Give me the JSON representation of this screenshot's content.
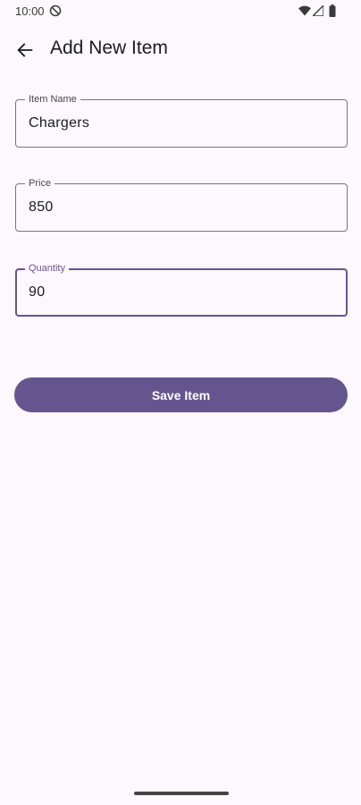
{
  "status_bar": {
    "time": "10:00",
    "icons": [
      "do-not-disturb-icon",
      "wifi-icon",
      "signal-icon",
      "battery-icon"
    ]
  },
  "app_bar": {
    "title": "Add New Item",
    "back_icon": "arrow-left-icon"
  },
  "form": {
    "item_name": {
      "label": "Item Name",
      "value": "Chargers"
    },
    "price": {
      "label": "Price",
      "value": "850"
    },
    "quantity": {
      "label": "Quantity",
      "value": "90",
      "focused": true
    }
  },
  "actions": {
    "save_label": "Save Item"
  },
  "colors": {
    "background": "#FDF7FE",
    "primary": "#65558F",
    "outline": "#79747E",
    "on_surface": "#1D1B20"
  }
}
